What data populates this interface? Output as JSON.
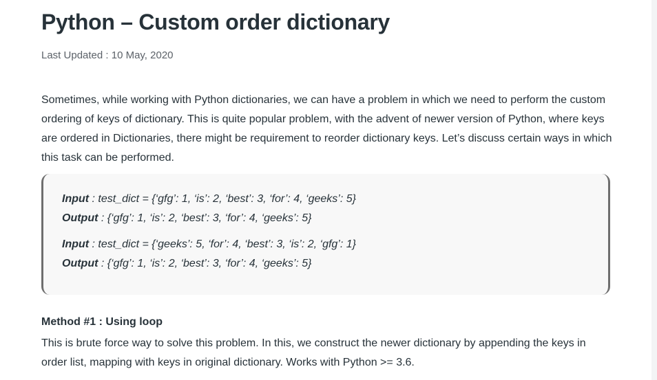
{
  "article": {
    "title": "Python – Custom order dictionary",
    "last_updated": "Last Updated : 10 May, 2020",
    "intro": "Sometimes, while working with Python dictionaries, we can have a problem in which we need to perform the custom ordering of keys of dictionary. This is quite popular problem, with the advent of newer version of Python, where keys are ordered in Dictionaries, there might be requirement to reorder dictionary keys. Let’s discuss certain ways in which this task can be performed.",
    "examples": [
      {
        "input_label": "Input",
        "input_text": " : test_dict = {‘gfg’: 1, ‘is’: 2, ‘best’: 3, ‘for’: 4, ‘geeks’: 5}",
        "output_label": "Output",
        "output_text": " : {‘gfg’: 1, ‘is’: 2, ‘best’: 3, ‘for’: 4, ‘geeks’: 5}"
      },
      {
        "input_label": "Input",
        "input_text": " : test_dict = {‘geeks’: 5, ‘for’: 4, ‘best’: 3, ‘is’: 2, ‘gfg’: 1}",
        "output_label": "Output",
        "output_text": " : {‘gfg’: 1, ‘is’: 2, ‘best’: 3, ‘for’: 4, ‘geeks’: 5}"
      }
    ],
    "method_title": "Method #1 : Using loop",
    "method_body": "This is brute force way to solve this problem. In this, we construct the newer dictionary by appending the keys in order list, mapping with keys in original dictionary. Works with Python >= 3.6."
  }
}
